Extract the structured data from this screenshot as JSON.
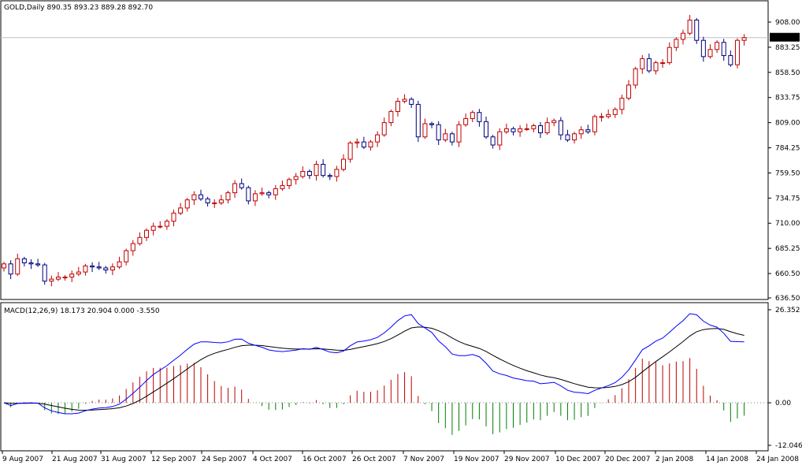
{
  "window": {
    "header_text": "GOLD,Daily  890.35 893.23 889.28 892.70",
    "current_price_label": "892.70"
  },
  "colors": {
    "bull_candle": "#c00000",
    "bear_candle": "#00007f",
    "macd_line": "#0000ff",
    "signal_line": "#000000",
    "histogram_positive": "#c00000",
    "histogram_negative": "#007f00",
    "grid": "#c0c0c0",
    "current_price_bg": "#000000",
    "current_price_fg": "#ffffff"
  },
  "chart_data": [
    {
      "type": "candlestick",
      "symbol": "GOLD",
      "timeframe": "Daily",
      "last_bar": {
        "open": 890.35,
        "high": 893.23,
        "low": 889.28,
        "close": 892.7
      },
      "price_ticks": [
        "908.00",
        "883.25",
        "858.50",
        "833.75",
        "809.00",
        "784.25",
        "759.50",
        "734.75",
        "710.00",
        "685.25",
        "660.50",
        "636.50"
      ],
      "ylim": [
        636.5,
        923.0
      ],
      "date_ticks": [
        "9 Aug 2007",
        "21 Aug 2007",
        "31 Aug 2007",
        "12 Sep 2007",
        "24 Sep 2007",
        "4 Oct 2007",
        "16 Oct 2007",
        "26 Oct 2007",
        "7 Nov 2007",
        "19 Nov 2007",
        "29 Nov 2007",
        "10 Dec 2007",
        "20 Dec 2007",
        "2 Jan 2008",
        "14 Jan 2008",
        "24 Jan 2008"
      ],
      "closes": [
        670,
        660,
        675,
        671,
        670,
        669,
        653,
        655,
        657,
        657,
        660,
        662,
        668,
        667,
        666,
        664,
        667,
        672,
        683,
        690,
        696,
        703,
        707,
        707,
        712,
        720,
        725,
        733,
        738,
        734,
        730,
        730,
        733,
        740,
        749,
        745,
        732,
        739,
        740,
        738,
        744,
        747,
        753,
        756,
        761,
        757,
        768,
        757,
        756,
        763,
        773,
        789,
        790,
        785,
        790,
        797,
        809,
        820,
        830,
        832,
        827,
        795,
        808,
        807,
        792,
        798,
        790,
        807,
        813,
        819,
        810,
        795,
        787,
        800,
        803,
        800,
        803,
        803,
        806,
        799,
        809,
        811,
        797,
        792,
        798,
        802,
        800,
        815,
        815,
        817,
        822,
        833,
        846,
        862,
        872,
        860,
        868,
        868,
        883,
        891,
        897,
        910,
        890,
        874,
        881,
        888,
        875,
        866,
        890,
        892.7
      ],
      "title": "GOLD,Daily"
    },
    {
      "type": "macd",
      "title": "MACD(12,26,9) 18.173 20.904 0.000 -3.550",
      "parameters": [
        12,
        26,
        9
      ],
      "values_shown": [
        18.173,
        20.904,
        0.0,
        -3.55
      ],
      "y_ticks": [
        "26.352",
        "0.00",
        "-12.046"
      ],
      "ylim": [
        -12.046,
        26.352
      ]
    }
  ]
}
